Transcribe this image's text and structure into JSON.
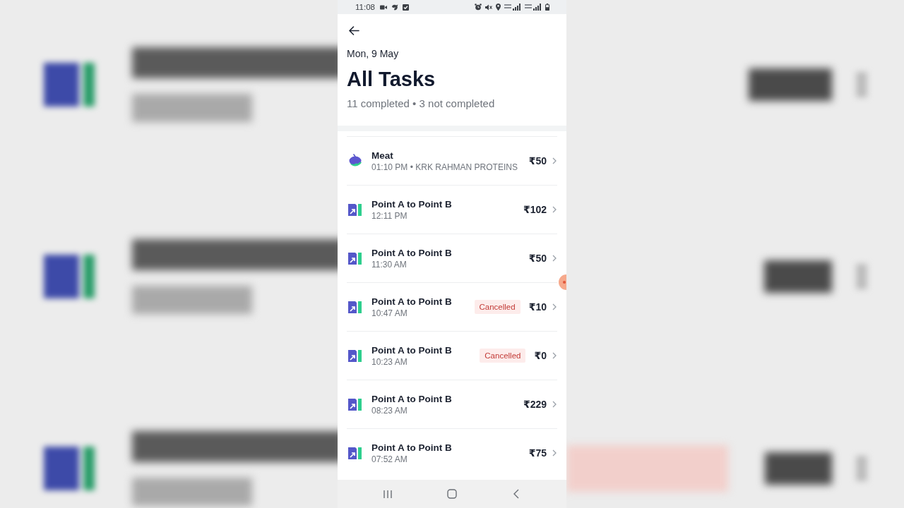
{
  "status_bar": {
    "time": "11:08"
  },
  "header": {
    "date": "Mon, 9 May",
    "title": "All Tasks",
    "summary": "11 completed • 3 not completed"
  },
  "tasks": [
    {
      "kind": "grocery",
      "title": "Meat",
      "subtitle": "01:10 PM • KRK RAHMAN PROTEINS",
      "amount": "₹50"
    },
    {
      "kind": "trip",
      "title": "Point A to Point B",
      "subtitle": "12:11 PM",
      "amount": "₹102"
    },
    {
      "kind": "trip",
      "title": "Point A to Point B",
      "subtitle": "11:30 AM",
      "amount": "₹50"
    },
    {
      "kind": "trip",
      "title": "Point A to Point B",
      "subtitle": "10:47 AM",
      "status": "Cancelled",
      "amount": "₹10"
    },
    {
      "kind": "trip",
      "title": "Point A to Point B",
      "subtitle": "10:23 AM",
      "status": "Cancelled",
      "amount": "₹0"
    },
    {
      "kind": "trip",
      "title": "Point A to Point B",
      "subtitle": "08:23 AM",
      "amount": "₹229"
    },
    {
      "kind": "trip",
      "title": "Point A to Point B",
      "subtitle": "07:52 AM",
      "amount": "₹75"
    }
  ]
}
